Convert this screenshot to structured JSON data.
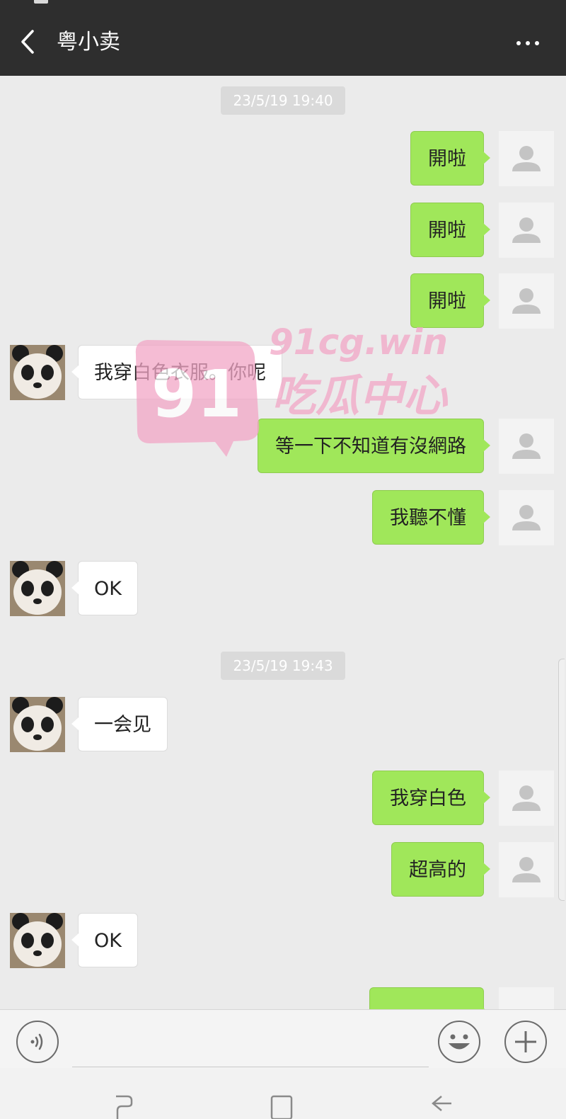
{
  "header": {
    "title": "粤小卖"
  },
  "messages": [
    {
      "type": "timestamp",
      "text": "23/5/19 19:40"
    },
    {
      "type": "sent",
      "text": "開啦"
    },
    {
      "type": "sent",
      "text": "開啦"
    },
    {
      "type": "sent",
      "text": "開啦"
    },
    {
      "type": "received",
      "text": "我穿白色衣服。你呢"
    },
    {
      "type": "sent",
      "text": "等一下不知道有沒網路"
    },
    {
      "type": "sent",
      "text": "我聽不懂"
    },
    {
      "type": "received",
      "text": "OK"
    },
    {
      "type": "timestamp",
      "text": "23/5/19 19:43"
    },
    {
      "type": "received",
      "text": "一会见"
    },
    {
      "type": "sent",
      "text": "我穿白色"
    },
    {
      "type": "sent",
      "text": "超高的"
    },
    {
      "type": "received",
      "text": "OK"
    }
  ],
  "watermark": {
    "number": "91",
    "domain": "91cg.win",
    "name": "吃瓜中心"
  },
  "colors": {
    "header": "#2e2e2e",
    "sent_bubble": "#a0e75a",
    "received_bubble": "#ffffff",
    "chat_background": "#ebebeb"
  },
  "icons": {
    "back": "chevron-left-icon",
    "more": "more-dots-icon",
    "voice": "voice-icon",
    "emoji": "emoji-icon",
    "plus": "plus-icon",
    "default_avatar": "default-avatar-icon",
    "contact_avatar": "panda-avatar-icon"
  }
}
